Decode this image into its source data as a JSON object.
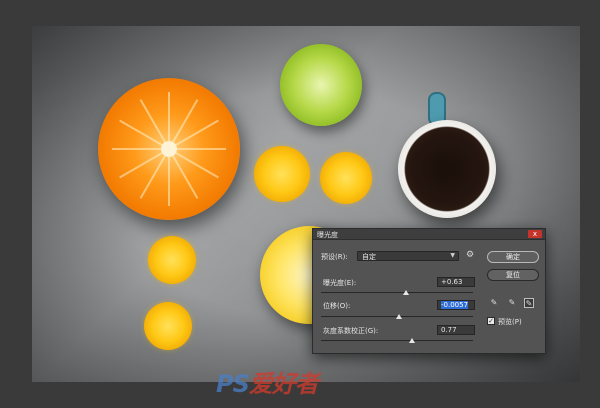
{
  "dialog": {
    "title": "曝光度",
    "close_label": "x",
    "preset_label": "预设(R):",
    "preset_value": "自定",
    "exposure_label": "曝光度(E):",
    "exposure_value": "+0.63",
    "offset_label": "位移(O):",
    "offset_value": "-0.0057",
    "gamma_label": "灰度系数校正(G):",
    "gamma_value": "0.77",
    "ok_label": "确定",
    "reset_label": "复位",
    "preview_label": "预览(P)",
    "preview_checked": true
  },
  "icons": {
    "gear": "gear-icon",
    "eyedropper_black": "eyedropper-black-icon",
    "eyedropper_gray": "eyedropper-gray-icon",
    "eyedropper_white": "eyedropper-white-icon"
  },
  "watermark": {
    "part1": "PS",
    "part2": "爱好者"
  },
  "colors": {
    "close": "#c4342a",
    "selection": "#2f6ed6",
    "dialog_bg": "#535353"
  }
}
